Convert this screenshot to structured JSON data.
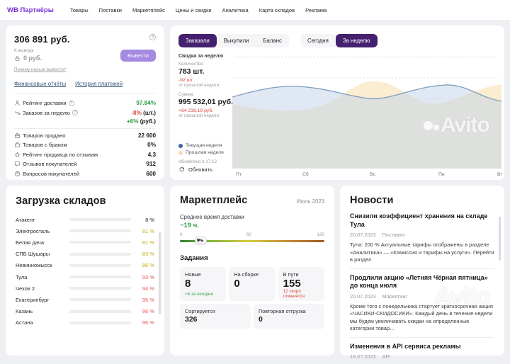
{
  "nav": {
    "logo": "WB Партнёры",
    "items": [
      "Товары",
      "Поставки",
      "Маркетплейс",
      "Цены и скидки",
      "Аналитика",
      "Карта складов",
      "Реклама"
    ]
  },
  "balance": {
    "total": "306 891 руб.",
    "to_withdraw_label": "К выводу",
    "to_withdraw_value": "0 руб.",
    "why_link": "Почему нельзя вывести?",
    "withdraw_button": "Вывести",
    "links": [
      "Финансовые отчёты",
      "История платежей"
    ]
  },
  "stats": {
    "rows": [
      {
        "icon": "person-icon",
        "label": "Рейтинг доставки",
        "help": true,
        "value": "97.84%",
        "value_color": "green"
      },
      {
        "icon": "trend-down-icon",
        "label": "Заказов за неделю",
        "help": true,
        "value": "-8%",
        "value_color": "red",
        "suffix": " (шт.)",
        "value2": "+6%",
        "value2_color": "green",
        "suffix2": " (руб.)",
        "divider_after": true
      },
      {
        "icon": "package-sold-icon",
        "label": "Товаров продано",
        "value": "22 600"
      },
      {
        "icon": "package-defect-icon",
        "label": "Товаров с браком",
        "value": "0%"
      },
      {
        "icon": "star-icon",
        "label": "Рейтинг продавца по отзывам",
        "value": "4,3"
      },
      {
        "icon": "chat-icon",
        "label": "Отзывов покупателей",
        "value": "912"
      },
      {
        "icon": "question-icon",
        "label": "Вопросов покупателей",
        "value": "600"
      }
    ]
  },
  "chart_panel": {
    "summary_tabs": [
      "Заказали",
      "Выкупили",
      "Баланс"
    ],
    "summary_active": 0,
    "period_tabs": [
      "Сегодня",
      "За неделю"
    ],
    "period_active": 1,
    "summary_title": "Сводка за неделю",
    "quantity_label": "Количество",
    "quantity": "783 шт.",
    "quantity_delta": "-92 шт.",
    "quantity_note": "от прошлой недели",
    "sum_label": "Сумма",
    "sum": "995 532,01 руб.",
    "sum_delta": "+64 238,19 руб.",
    "sum_note": "от прошлой недели",
    "legend": [
      {
        "label": "Текущая неделя",
        "color": "#3e6b9e"
      },
      {
        "label": "Прошлая неделя",
        "color": "#f4dfae"
      }
    ],
    "updated": "обновлено в 17:12",
    "refresh_label": "Обновить"
  },
  "chart_data": {
    "type": "area",
    "x": [
      "Пт",
      "Сб",
      "Вс",
      "Пн",
      "Вт"
    ],
    "series": [
      {
        "name": "Текущая неделя",
        "color": "#3e6b9e",
        "values_relative": [
          69,
          79,
          67,
          81,
          66
        ]
      },
      {
        "name": "Прошлая неделя",
        "color": "#f4dfae",
        "values_relative": [
          62,
          57,
          84,
          60,
          81
        ]
      }
    ],
    "ylabel": "",
    "xlabel": "",
    "grid": "dashed horizontal, no y tick labels"
  },
  "warehouses": {
    "title": "Загрузка складов",
    "rows": [
      {
        "name": "Атакент",
        "pct": 8,
        "pct_label": "8 %",
        "level": "green"
      },
      {
        "name": "Электросталь",
        "pct": 81,
        "pct_label": "81 %",
        "level": "yellow"
      },
      {
        "name": "Белая дача",
        "pct": 81,
        "pct_label": "81 %",
        "level": "yellow"
      },
      {
        "name": "СПБ Шушары",
        "pct": 83,
        "pct_label": "83 %",
        "level": "yellow"
      },
      {
        "name": "Невинномысск",
        "pct": 86,
        "pct_label": "86 %",
        "level": "yellow"
      },
      {
        "name": "Тула",
        "pct": 93,
        "pct_label": "93 %",
        "level": "red"
      },
      {
        "name": "Чехов 2",
        "pct": 94,
        "pct_label": "94 %",
        "level": "red"
      },
      {
        "name": "Екатеринбург",
        "pct": 95,
        "pct_label": "95 %",
        "level": "red"
      },
      {
        "name": "Казань",
        "pct": 96,
        "pct_label": "96 %",
        "level": "red"
      },
      {
        "name": "Астана",
        "pct": 96,
        "pct_label": "96 %",
        "level": "red"
      }
    ]
  },
  "marketplace": {
    "title": "Маркетплейс",
    "period": "Июль 2023",
    "delivery_label": "Среднее время доставки",
    "delivery_value": "~19 ч.",
    "scale": [
      "0",
      "60",
      "120"
    ],
    "truck_pos_pct": 14,
    "tasks_title": "Задания",
    "cards": [
      {
        "label": "Новые",
        "value": "8",
        "note": "+4 за сегодня",
        "note_color": "green",
        "size": "c3"
      },
      {
        "label": "На сборке",
        "value": "0",
        "size": "c3"
      },
      {
        "label": "В пути",
        "value": "155",
        "note": "12 скоро отменятся",
        "note_color": "red",
        "size": "c3"
      },
      {
        "label": "Сортируется",
        "value": "326",
        "size": "c2"
      },
      {
        "label": "Повторная отгрузка",
        "value": "0",
        "size": "c2"
      }
    ]
  },
  "news": {
    "title": "Новости",
    "items": [
      {
        "title": "Снизили коэффициент хранения на складе Тула",
        "date": "20.07.2023",
        "category": "Поставки",
        "body": "Тула: 200 % Актуальные тарифы отображены в разделе «Аналитика» — «Комиссия и тарифы на услуги». Перейти в раздел"
      },
      {
        "title": "Продлили акцию «Летняя Чёрная пятница» до конца июля",
        "date": "20.07.2023",
        "category": "Маркетинг",
        "body": "Кроме того с понедельника стартует краткосрочная акция «ЧАСИКИ-СКИДОСИКИ». Каждый день в течение недели мы будем увеличивать скидки на определенные категории товар…"
      },
      {
        "title": "Изменения в API сервиса рекламы",
        "date": "19.07.2023",
        "category": "API",
        "body": ""
      }
    ]
  },
  "watermark": {
    "text": "Avito"
  },
  "colors": {
    "brand_purple": "#7a30d9",
    "tab_active": "#44206f",
    "withdraw_button": "#a48ae0",
    "positive_green": "#2f9e44",
    "negative_red": "#d9443c",
    "bar_yellow": "#d9c419",
    "bar_red": "#f0555a",
    "chart_blue_line": "#7d9cc0",
    "chart_blue_fill": "#dce7f3",
    "chart_yellow_fill": "#f8e7c2"
  }
}
